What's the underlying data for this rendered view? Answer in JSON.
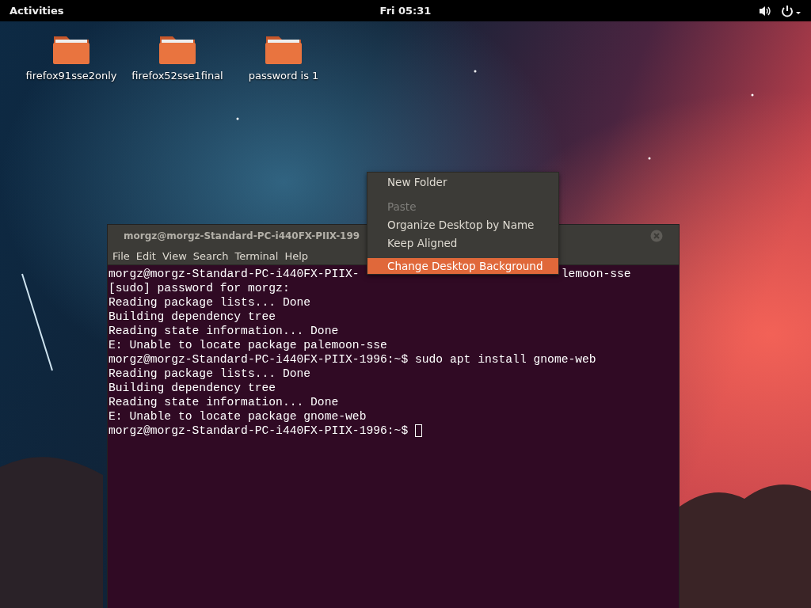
{
  "top_bar": {
    "activities": "Activities",
    "clock": "Fri 05:31"
  },
  "desktop_icons": [
    {
      "label": "firefox91sse2only"
    },
    {
      "label": "firefox52sse1final"
    },
    {
      "label": "password is 1"
    }
  ],
  "terminal": {
    "title": "morgz@morgz-Standard-PC-i440FX-PIIX-199",
    "menu": [
      "File",
      "Edit",
      "View",
      "Search",
      "Terminal",
      "Help"
    ],
    "lines": [
      {
        "text": "morgz@morgz-Standard-PC-i440FX-PIIX-",
        "tail": "lemoon-sse"
      },
      {
        "text": "[sudo] password for morgz:"
      },
      {
        "text": "Reading package lists... Done"
      },
      {
        "text": "Building dependency tree"
      },
      {
        "text": "Reading state information... Done"
      },
      {
        "text": "E: Unable to locate package palemoon-sse"
      },
      {
        "text": "morgz@morgz-Standard-PC-i440FX-PIIX-1996:~$ sudo apt install gnome-web"
      },
      {
        "text": "Reading package lists... Done"
      },
      {
        "text": "Building dependency tree"
      },
      {
        "text": "Reading state information... Done"
      },
      {
        "text": "E: Unable to locate package gnome-web"
      },
      {
        "text": "morgz@morgz-Standard-PC-i440FX-PIIX-1996:~$ ",
        "cursor": true
      }
    ]
  },
  "context_menu": {
    "items": [
      {
        "kind": "item",
        "label": "New Folder",
        "disabled": false,
        "selected": false
      },
      {
        "kind": "separator"
      },
      {
        "kind": "item",
        "label": "Paste",
        "disabled": true,
        "selected": false
      },
      {
        "kind": "item",
        "label": "Organize Desktop by Name",
        "disabled": false,
        "selected": false
      },
      {
        "kind": "item",
        "label": "Keep Aligned",
        "disabled": false,
        "selected": false
      },
      {
        "kind": "separator"
      },
      {
        "kind": "item",
        "label": "Change Desktop Background",
        "disabled": false,
        "selected": true
      }
    ]
  }
}
